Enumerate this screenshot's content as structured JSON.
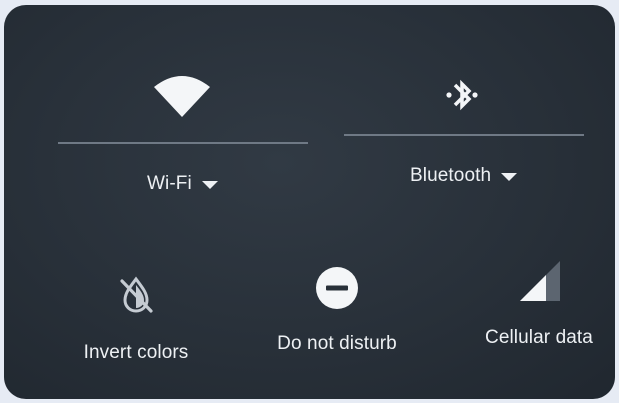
{
  "quick_settings": {
    "wifi": {
      "label": "Wi-Fi",
      "icon": "wifi-icon"
    },
    "bluetooth": {
      "label": "Bluetooth",
      "icon": "bluetooth-icon"
    },
    "invert_colors": {
      "label": "Invert colors",
      "icon": "invert-colors-off-icon"
    },
    "do_not_disturb": {
      "label": "Do not disturb",
      "icon": "do-not-disturb-icon"
    },
    "cellular_data": {
      "label": "Cellular data",
      "icon": "cellular-signal-icon"
    }
  },
  "colors": {
    "panel_background": "#283039",
    "icon_foreground": "#eef1f4",
    "divider": "#6f7985"
  }
}
